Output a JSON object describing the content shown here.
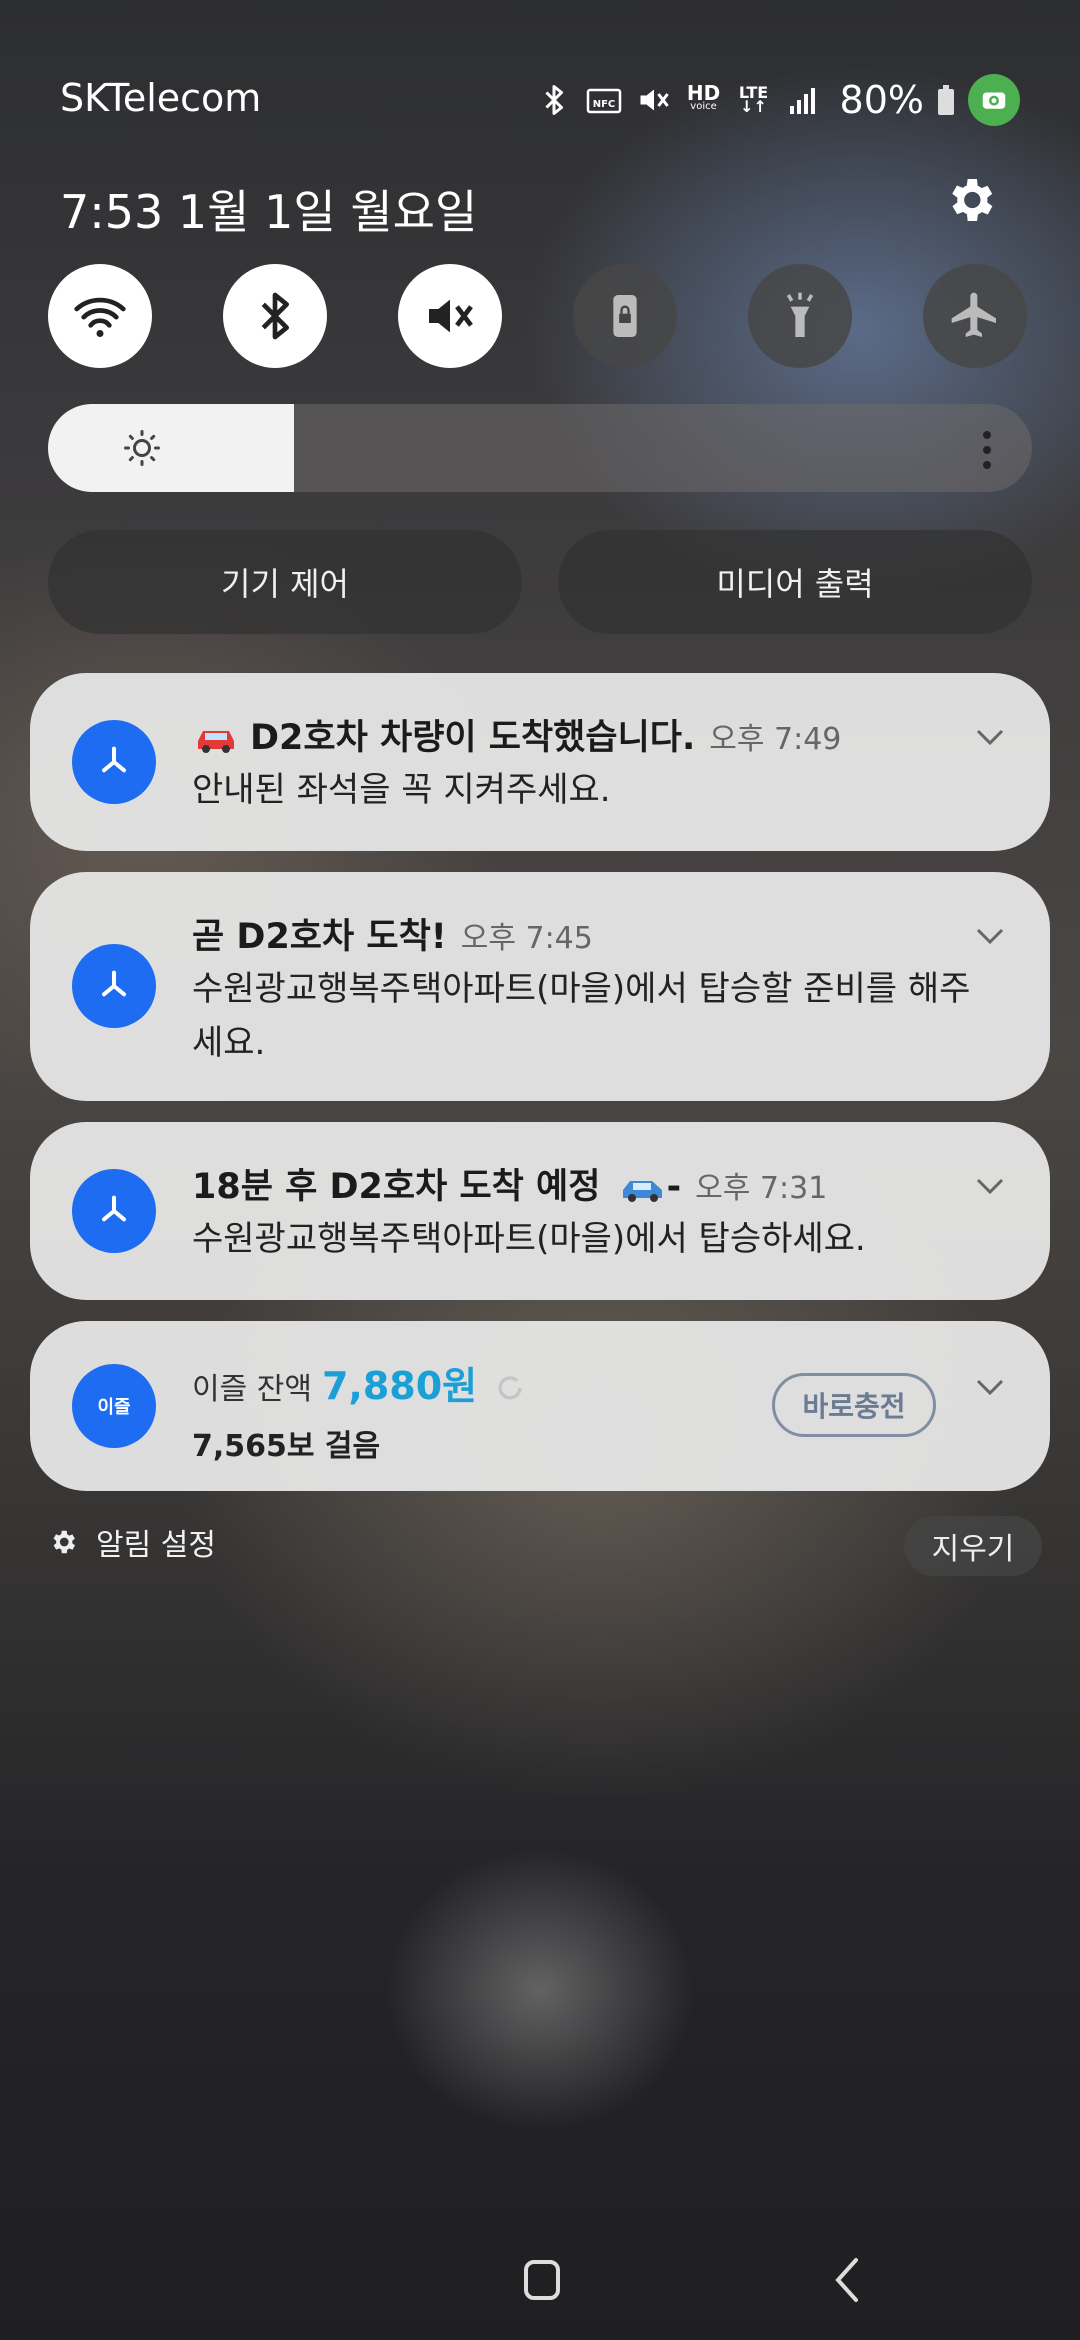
{
  "status_bar": {
    "carrier": "SKTelecom",
    "battery": "80%",
    "icons": [
      "bluetooth-icon",
      "nfc-icon",
      "mute-icon",
      "hd-voice-icon",
      "lte-icon",
      "signal-icon",
      "battery-icon",
      "screen-recorder-icon"
    ],
    "nfc_label": "NFC",
    "hd_label": "HD",
    "voice_label": "voice",
    "lte_label": "LTE"
  },
  "header": {
    "datetime": "7:53  1월 1일 월요일"
  },
  "quick_toggles": [
    {
      "name": "wifi",
      "on": true
    },
    {
      "name": "bluetooth",
      "on": true
    },
    {
      "name": "mute",
      "on": true
    },
    {
      "name": "screen-lock",
      "on": false
    },
    {
      "name": "flashlight",
      "on": false
    },
    {
      "name": "airplane-mode",
      "on": false
    }
  ],
  "brightness": {
    "level": 0.25
  },
  "buttons": {
    "device_control": "기기 제어",
    "media_output": "미디어 출력"
  },
  "notifications": [
    {
      "title": "D2호차 차량이 도착했습니다.",
      "time": "오후 7:49",
      "body": "안내된 좌석을 꼭 지켜주세요.",
      "emoji": "red-car"
    },
    {
      "title": "곧 D2호차 도착!",
      "time": "오후 7:45",
      "body": "수원광교행복주택아파트(마을)에서 탑승할 준비를 해주세요."
    },
    {
      "title": "18분 후 D2호차 도착 예정",
      "title_suffix": "-",
      "time": "오후 7:31",
      "body": "수원광교행복주택아파트(마을)에서 탑승하세요.",
      "emoji": "blue-car"
    }
  ],
  "idid_card": {
    "app_label": "이즐",
    "balance_label": "이즐 잔액",
    "balance": "7,880원",
    "steps": "7,565보 걸음",
    "recharge_button": "바로충전"
  },
  "footer": {
    "notification_settings": "알림 설정",
    "clear_button": "지우기"
  },
  "colors": {
    "accent_blue": "#1e6cf2",
    "balance_cyan": "#1aa0d6",
    "screen_recorder_green": "#4caf50"
  }
}
